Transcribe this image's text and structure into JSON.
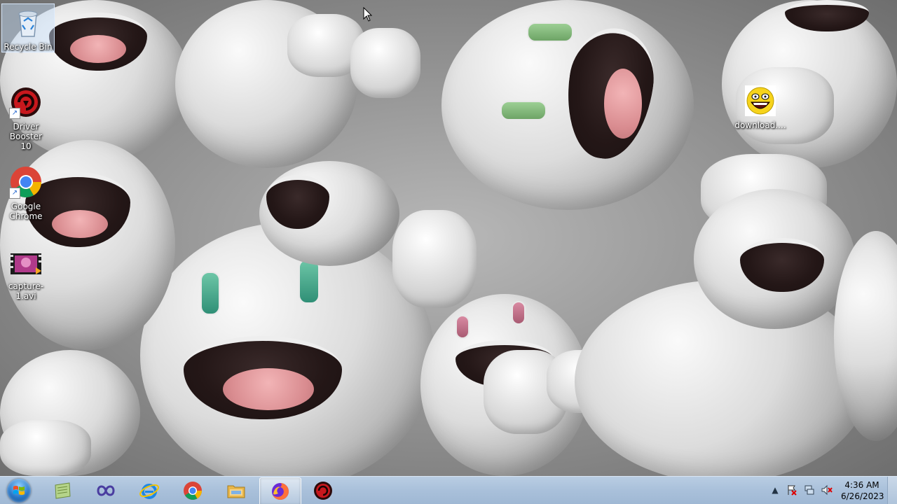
{
  "desktop": {
    "icons": [
      {
        "label": "Recycle Bin",
        "icon": "recycle-bin-icon"
      },
      {
        "label": "Driver Booster 10",
        "icon": "driver-booster-icon"
      },
      {
        "label": "Google Chrome",
        "icon": "chrome-icon"
      },
      {
        "label": "capture-1.avi",
        "icon": "video-file-icon"
      },
      {
        "label": "download....",
        "icon": "smiley-image-icon"
      }
    ]
  },
  "taskbar": {
    "start_label": "Start",
    "pinned": [
      {
        "name": "notepad-icon"
      },
      {
        "name": "visual-studio-icon"
      },
      {
        "name": "internet-explorer-icon"
      },
      {
        "name": "chrome-icon"
      },
      {
        "name": "file-explorer-icon"
      },
      {
        "name": "firefox-icon",
        "active": true
      },
      {
        "name": "driver-booster-icon"
      }
    ],
    "tray": {
      "icons": [
        "show-hidden-icons-arrow",
        "network-flag-icon",
        "network-icon",
        "volume-muted-icon"
      ],
      "time": "4:36 AM",
      "date": "6/26/2023"
    }
  },
  "colors": {
    "taskbar": "#a9c0da",
    "accent": "#2a78c8"
  }
}
